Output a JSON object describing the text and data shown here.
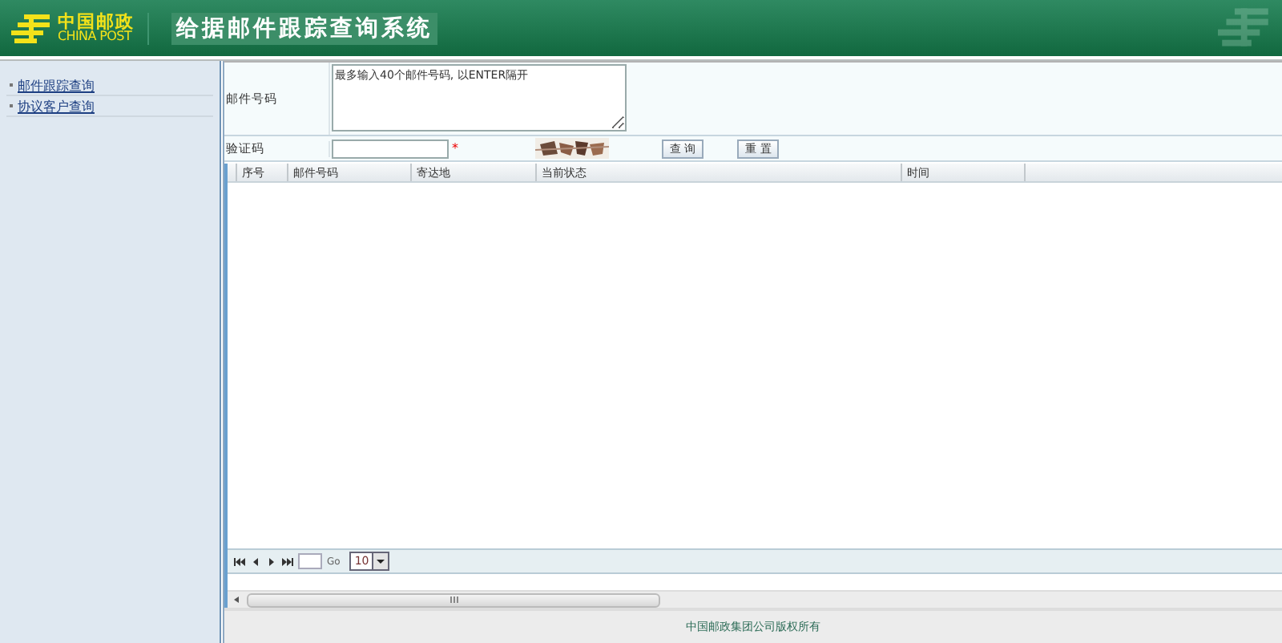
{
  "header": {
    "logo_cn": "中国邮政",
    "logo_en": "CHINA POST",
    "title": "给据邮件跟踪查询系统"
  },
  "sidebar": {
    "items": [
      {
        "label": "邮件跟踪查询"
      },
      {
        "label": "协议客户查询"
      }
    ]
  },
  "form": {
    "mail_number": {
      "label": "邮件号码",
      "value": "最多输入40个邮件号码, 以ENTER隔开"
    },
    "captcha": {
      "label": "验证码",
      "required_mark": "*"
    },
    "buttons": [
      "查 询",
      "重 置"
    ]
  },
  "grid": {
    "columns": [
      "序号",
      "邮件号码",
      "寄达地",
      "当前状态",
      "时间"
    ]
  },
  "pager": {
    "go": "Go",
    "page_size": "10"
  },
  "footer": "中国邮政集团公司版权所有"
}
